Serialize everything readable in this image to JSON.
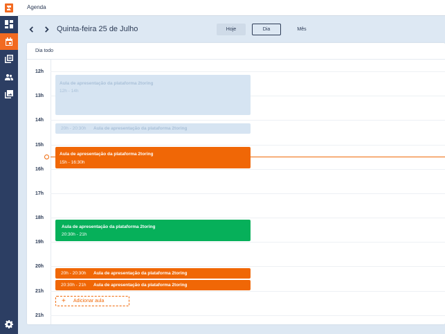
{
  "app": {
    "title": "Agenda"
  },
  "sidebar": {
    "items": [
      {
        "name": "dashboard",
        "icon": "dashboard-icon",
        "active": false
      },
      {
        "name": "agenda",
        "icon": "calendar-icon",
        "active": true
      },
      {
        "name": "courses",
        "icon": "library-icon",
        "active": false
      },
      {
        "name": "users",
        "icon": "people-icon",
        "active": false
      },
      {
        "name": "media",
        "icon": "photo-library-icon",
        "active": false
      }
    ],
    "settings_icon": "gear-icon"
  },
  "toolbar": {
    "prev_icon": "chevron-left-icon",
    "next_icon": "chevron-right-icon",
    "date_title": "Quinta-feira 25 de Julho",
    "views": {
      "today": "Hoje",
      "day": "Dia",
      "month": "Mês"
    },
    "active_view": "Dia"
  },
  "calendar": {
    "allday_label": "Dia todo",
    "hours": [
      "12h",
      "13h",
      "14h",
      "15h",
      "16h",
      "17h",
      "18h",
      "19h",
      "20h",
      "21h",
      "21h"
    ],
    "events": [
      {
        "title": "Aula de apresentação da plataforma 2toring",
        "time": "12h - 14h",
        "status": "past"
      },
      {
        "title": "Aula de apresentação da plataforma 2toring",
        "time": "20h - 20:30h",
        "status": "past"
      },
      {
        "title": "Aula de apresentação da plataforma 2toring",
        "time": "15h - 16:30h",
        "status": "current"
      },
      {
        "title": "Aula de apresentação da plataforma 2toring",
        "time": "20:30h - 21h",
        "status": "upcoming"
      },
      {
        "title": "Aula de apresentação da plataforma 2toring",
        "time": "20h - 20:30h",
        "status": "current"
      },
      {
        "title": "Aula de apresentação da plataforma 2toring",
        "time": "20:30h - 21h",
        "status": "current"
      }
    ],
    "add_button": {
      "plus": "+",
      "label": "Adicionar aula"
    }
  },
  "colors": {
    "accent": "#f06706",
    "success": "#06b05a",
    "sidebar": "#2c3e63",
    "past": "#d6e4f2"
  }
}
